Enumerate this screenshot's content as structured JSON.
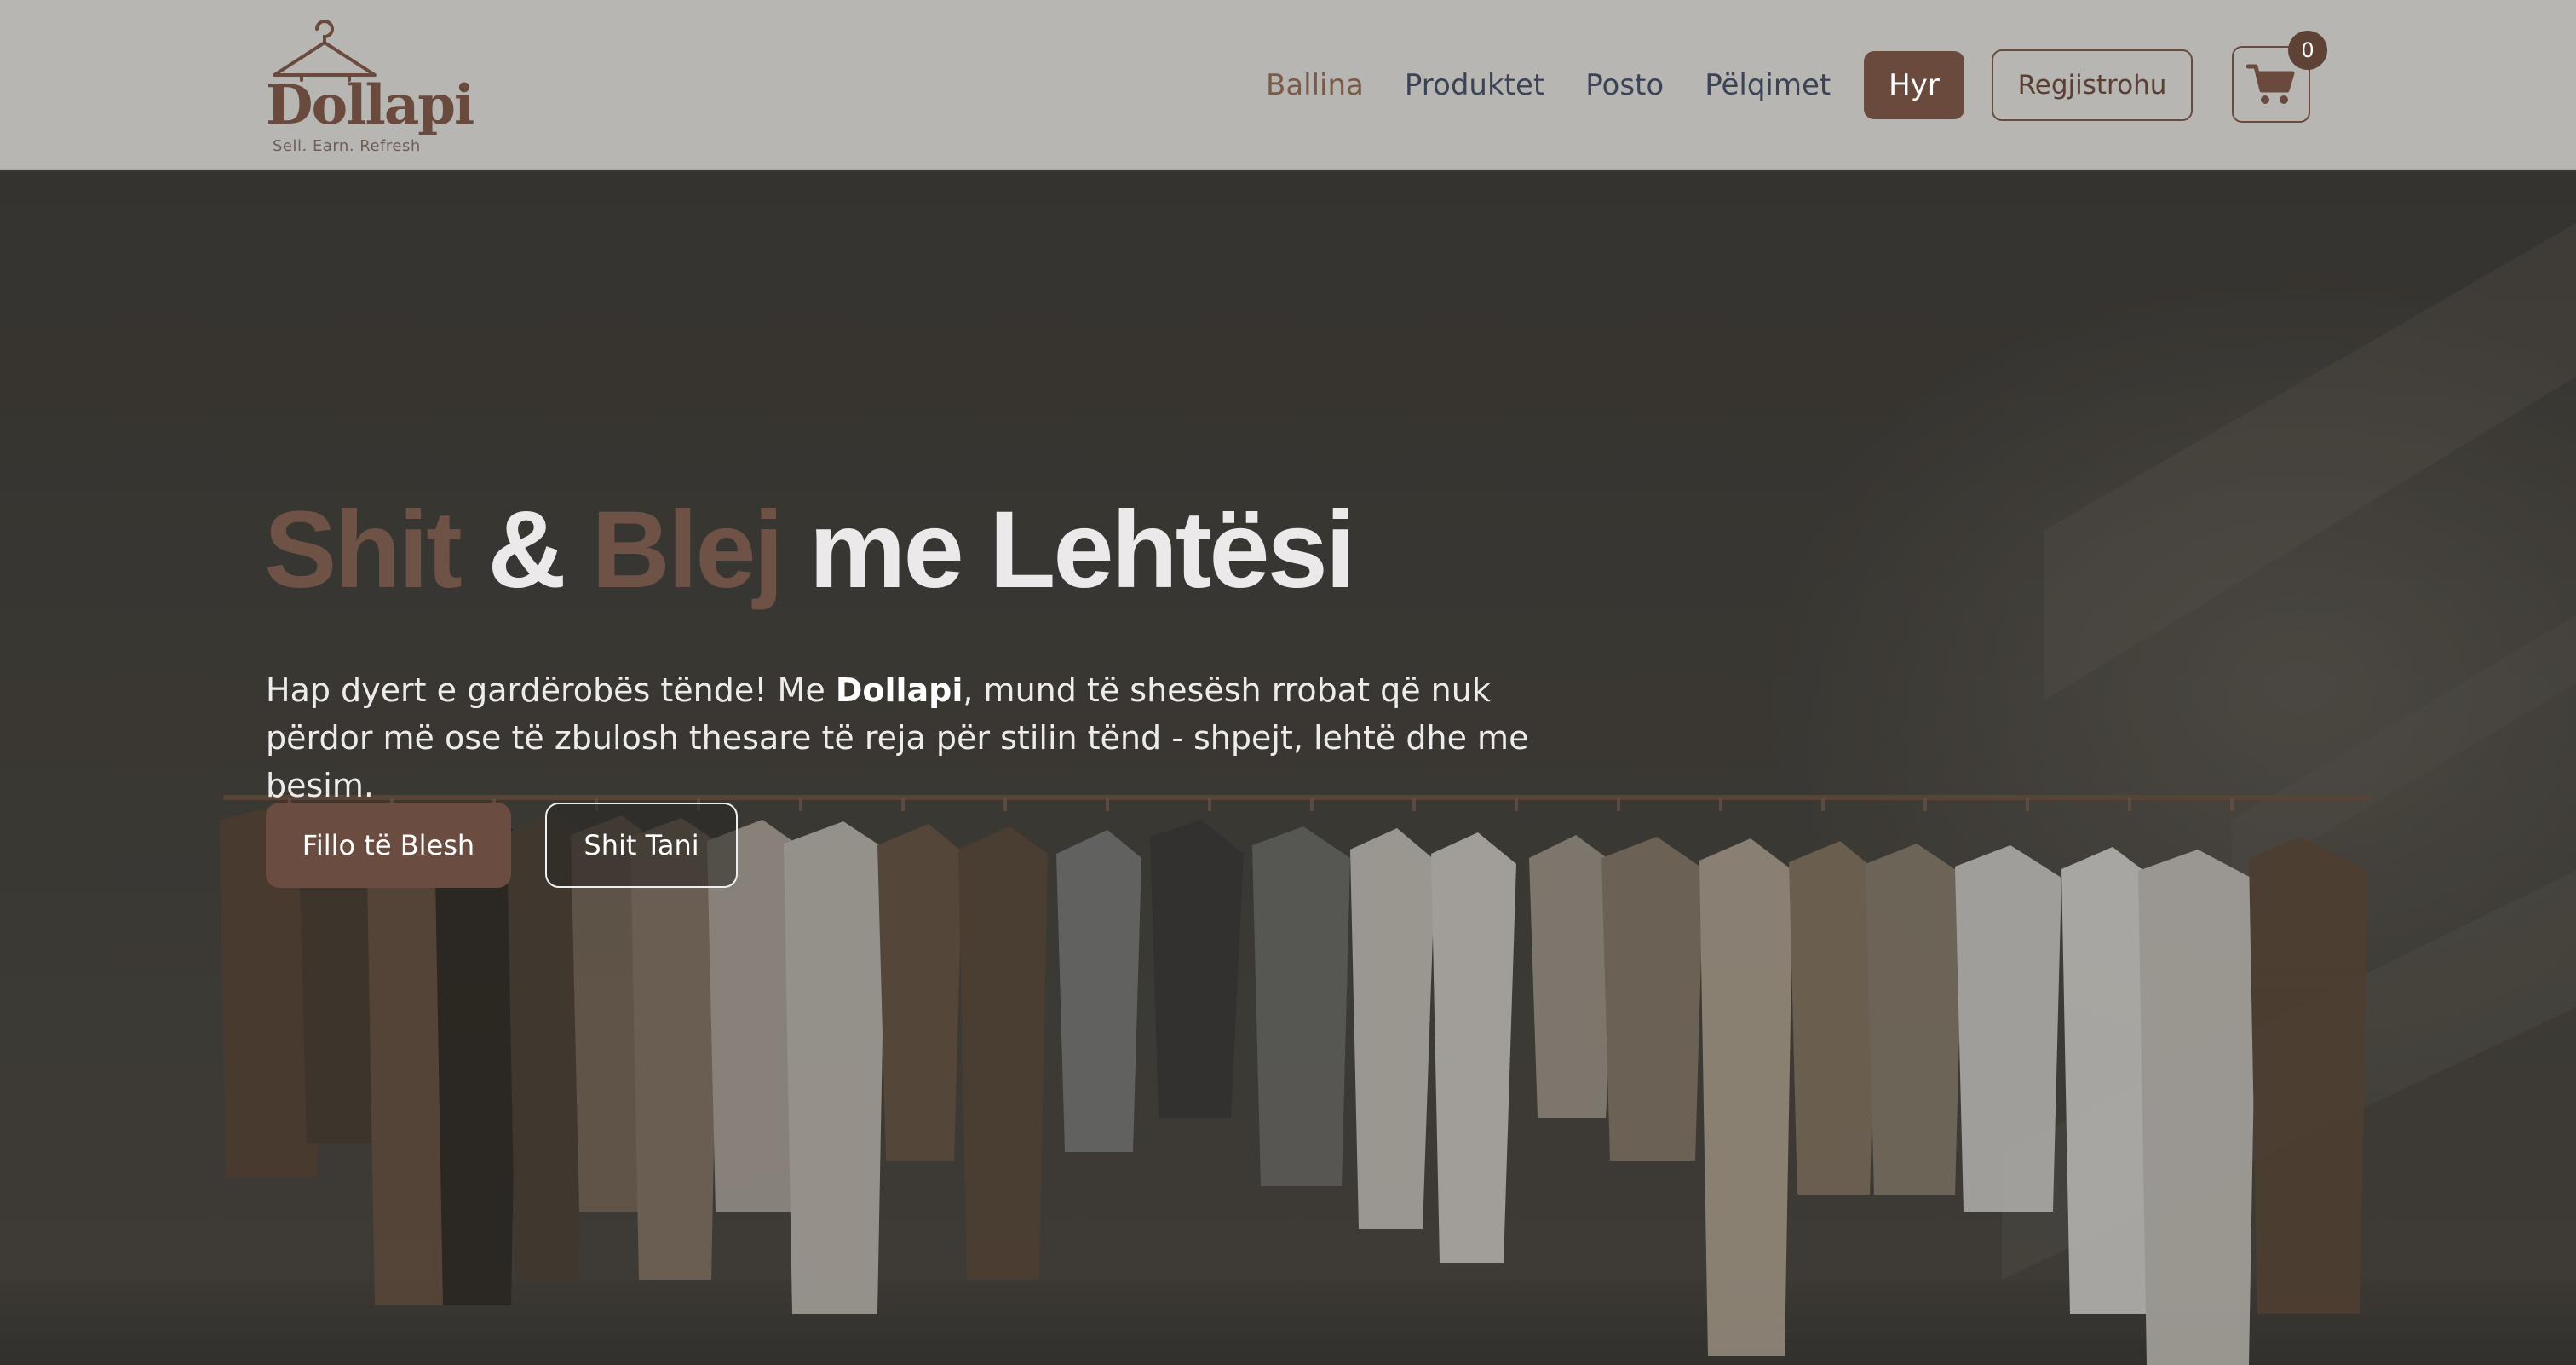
{
  "brand": {
    "name": "Dollapi",
    "tagline": "Sell. Earn. Refresh"
  },
  "nav": {
    "items": [
      {
        "label": "Ballina",
        "active": true
      },
      {
        "label": "Produktet",
        "active": false
      },
      {
        "label": "Posto",
        "active": false
      },
      {
        "label": "Pëlqimet",
        "active": false
      }
    ],
    "login_label": "Hyr",
    "register_label": "Regjistrohu",
    "cart_count": "0"
  },
  "hero": {
    "title_part1": "Shit",
    "title_amp": "&",
    "title_part2": "Blej",
    "title_part3": "me Lehtësi",
    "text_before": "Hap dyert e gardërobës tënde! Me ",
    "text_brand": "Dollapi",
    "text_after": ", mund të shesësh rrobat që nuk përdor më ose të zbulosh thesare të reja për stilin tënd - shpejt, lehtë dhe me besim.",
    "primary_button": "Fillo të Blesh",
    "secondary_button": "Shit Tani"
  },
  "icons": {
    "logo": "hanger-icon",
    "cart": "shopping-cart-icon"
  },
  "colors": {
    "brand_brown": "#6a4a3d",
    "header_bg": "#b8b6b2",
    "nav_text": "#3b4457",
    "nav_active": "#7a5a48"
  }
}
